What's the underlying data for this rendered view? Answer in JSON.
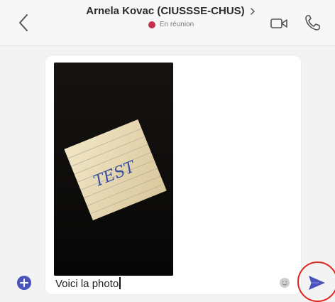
{
  "header": {
    "back_icon": "chevron-left-icon",
    "title": "Arnela Kovac (CIUSSSE-CHUS)",
    "title_chevron_icon": "chevron-right-icon",
    "status": {
      "text": "En réunion",
      "color": "#c4314b"
    },
    "video_icon": "video-camera-icon",
    "call_icon": "phone-icon"
  },
  "compose": {
    "attachment": {
      "type": "photo",
      "note_text": "TEST"
    },
    "message_value": "Voici la photo",
    "emoji_icon": "emoji-icon",
    "add_icon": "plus-icon",
    "send_icon": "send-icon"
  },
  "colors": {
    "accent": "#4b53bc",
    "highlight_ring": "#e1251b",
    "status_busy": "#c4314b"
  }
}
